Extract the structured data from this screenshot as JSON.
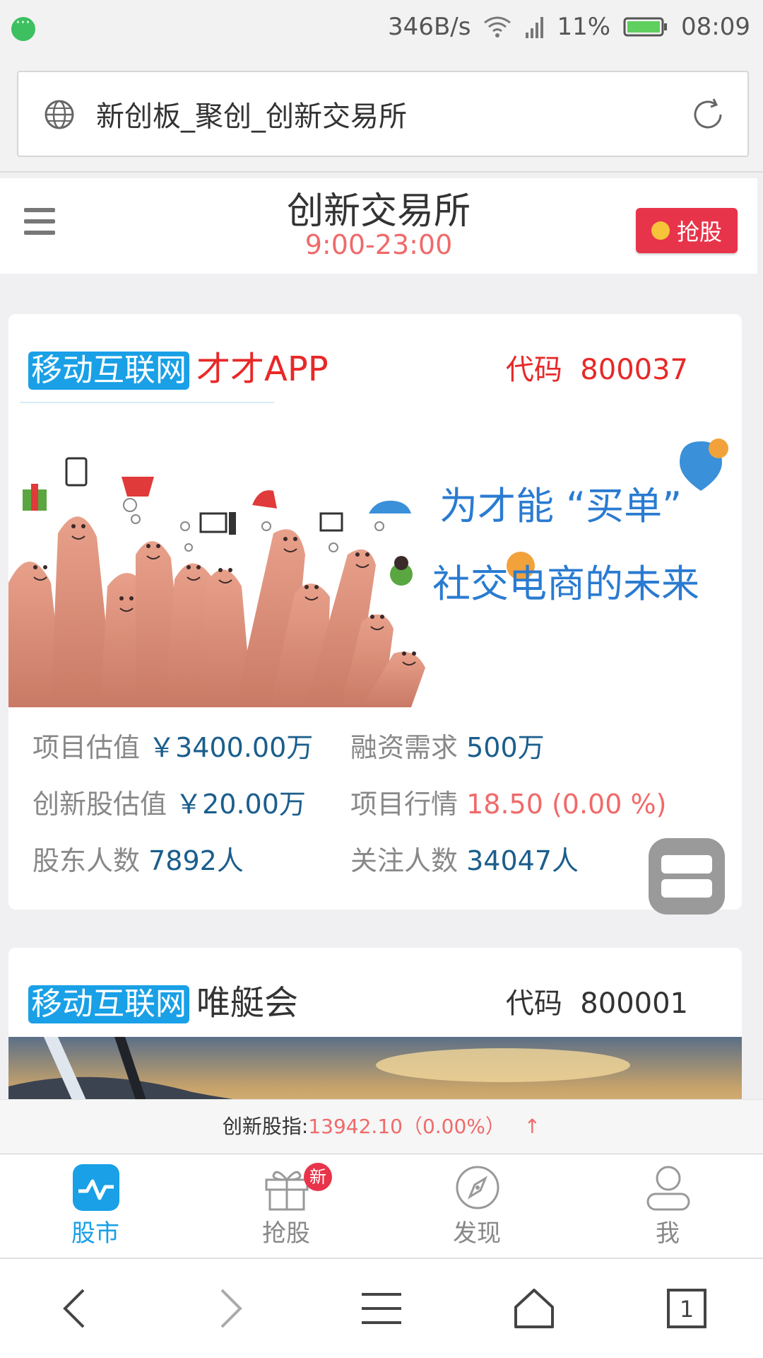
{
  "status_bar": {
    "net_speed": "346B/s",
    "battery": "11%",
    "time": "08:09"
  },
  "browser": {
    "url_title": "新创板_聚创_创新交易所",
    "tab_count": "1"
  },
  "header": {
    "title": "创新交易所",
    "hours": "9:00-23:00",
    "grab_button": "抢股"
  },
  "cards": [
    {
      "tag": "移动互联网",
      "name": "才才APP",
      "code_label": "代码",
      "code": "800037",
      "banner_line1": "为才能 “买单”",
      "banner_line2": "社交电商的未来",
      "stats": [
        {
          "k": "项目估值",
          "v": "￥3400.00万"
        },
        {
          "k": "融资需求",
          "v": "500万"
        },
        {
          "k": "创新股估值",
          "v": "￥20.00万"
        },
        {
          "k": "项目行情",
          "v": "18.50 (0.00 %)"
        },
        {
          "k": "股东人数",
          "v": "7892人"
        },
        {
          "k": "关注人数",
          "v": "34047人"
        }
      ]
    },
    {
      "tag": "移动互联网",
      "name": "唯艇会",
      "code_label": "代码",
      "code": "800001"
    }
  ],
  "index_bar": {
    "label": "创新股指:",
    "value": "13942.10（0.00%）",
    "arrow": "↑"
  },
  "tabs": [
    {
      "label": "股市",
      "icon": "chart-icon",
      "active": true
    },
    {
      "label": "抢股",
      "icon": "gift-icon",
      "badge": "新"
    },
    {
      "label": "发现",
      "icon": "compass-icon"
    },
    {
      "label": "我",
      "icon": "user-icon"
    }
  ],
  "colors": {
    "accent": "#19a0e6",
    "red": "#e8344a",
    "quote": "#f06a6a",
    "value": "#1b5e8c"
  }
}
